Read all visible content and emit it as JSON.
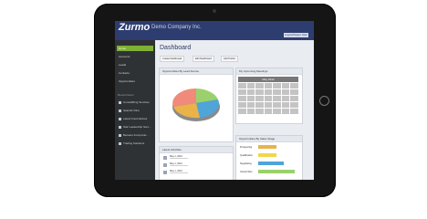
{
  "header": {
    "logo": "Zurmo",
    "company": "Demo Company Inc.",
    "user": "Logout/Super User"
  },
  "sidebar": {
    "items": [
      {
        "label": "Home"
      },
      {
        "label": "Accounts"
      },
      {
        "label": "Leads"
      },
      {
        "label": "Contacts"
      },
      {
        "label": "Opportunities"
      }
    ],
    "section_title": "Recent Items",
    "quick_items": [
      {
        "label": "ConsultRing Services"
      },
      {
        "label": "Spanish Dine"
      },
      {
        "label": "Latest Food Advisor"
      },
      {
        "label": "Star Leadership Serv..."
      },
      {
        "label": "Benelux Incorporat..."
      },
      {
        "label": "Trading Solutions"
      }
    ]
  },
  "main": {
    "title": "Dashboard",
    "toolbar": [
      {
        "label": "Create Dashboard"
      },
      {
        "label": "Edit Dashboard"
      },
      {
        "label": "Add Portlet"
      }
    ],
    "panels": {
      "pie_title": "Opportunities By Lead Source",
      "calendar_title": "My Upcoming Meetings",
      "calendar_month": "May 2012",
      "activities_title": "Latest Activities",
      "bars_title": "Opportunities By Sales Stage"
    },
    "activities": [
      {
        "label": "May 1, 2012"
      },
      {
        "label": "May 1, 2012"
      },
      {
        "label": "May 1, 2012"
      }
    ],
    "bar_labels": [
      "Prospecting",
      "Qualification",
      "Negotiating",
      "Closed Won"
    ]
  },
  "colors": {
    "header": "#2e3d6f",
    "sidebar": "#2f3235",
    "active": "#7fb234"
  }
}
